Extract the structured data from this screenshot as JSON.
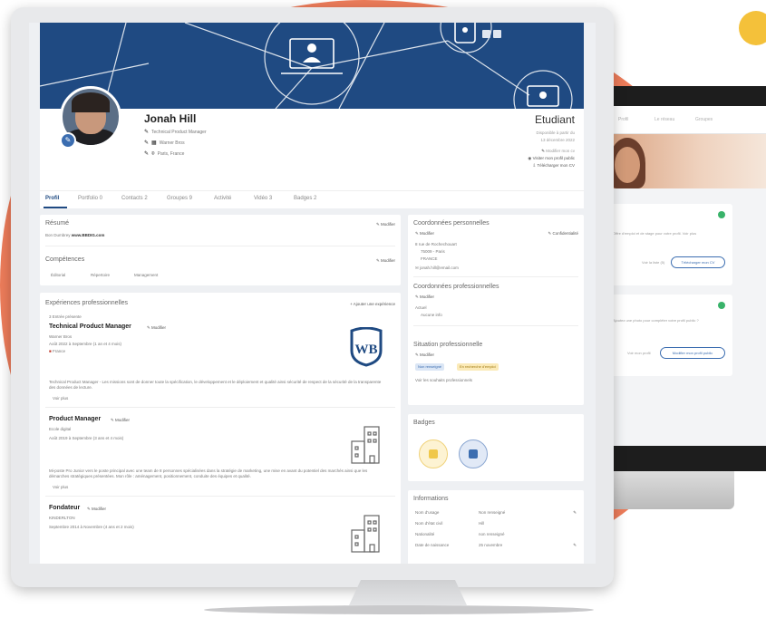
{
  "profile": {
    "name": "Jonah Hill",
    "title": "Technical Product Manager",
    "company": "Warner Bros",
    "location": "Paris, France",
    "status": "Etudiant",
    "availability_label": "Disponible à partir du",
    "availability_date": "13 décembre 2022",
    "edit_visibility": "Modifier mon cv",
    "view_public": "Visiter mon profil public",
    "download_cv": "Télécharger mon CV"
  },
  "tabs": [
    {
      "label": "Profil"
    },
    {
      "label": "Portfolio 0"
    },
    {
      "label": "Contacts 2"
    },
    {
      "label": "Groupes 9"
    },
    {
      "label": "Activité"
    },
    {
      "label": "Vidéo 3"
    },
    {
      "label": "Badges 2"
    }
  ],
  "summary": {
    "title": "Résumé",
    "edit": "Modifier",
    "text_prefix": "Bon Dumbrey",
    "text_strong": "www.BBDIG.com"
  },
  "skills": {
    "title": "Compétences",
    "edit": "Modifier",
    "items": [
      "Éditorial",
      "Répertoire",
      "Management"
    ]
  },
  "experience": {
    "title": "Expériences professionnelles",
    "add": "+ Ajouter une expérience",
    "count": "3 Entrée présente",
    "jobs": [
      {
        "title": "Technical Product Manager",
        "edit": "Modifier",
        "company": "Warner Bros",
        "dates": "Août 2022 à Septembre (1 an et 4 mois)",
        "location": "France",
        "desc": "Technical Product Manager - Les missions sont de donner toute la spécification, le développement et le déploiement et qualité ainsi sécurité de respect de la sécurité de la transparente des données de lecture.",
        "more": "Voir plus"
      },
      {
        "title": "Product Manager",
        "edit": "Modifier",
        "company": "Ecole digital",
        "dates": "Août 2019 à Septembre (3 ans et 4 mois)",
        "desc": "Mi-poste Pro Junior vers le poste principal avec une team de 8 personnes spécialisées dans la stratégie de marketing, une mise en avant du potentiel des marchés ainsi que les démarches stratégiques présentées. Mon rôle : aménagement, positionnement, conduite des équipes et qualité.",
        "more": "Voir plus"
      },
      {
        "title": "Fondateur",
        "edit": "Modifier",
        "company": "KINDERLTON",
        "dates": "Septembre 2014 à Novembre (4 ans et 2 mois)"
      }
    ]
  },
  "personal": {
    "title": "Coordonnées personnelles",
    "edit": "Modifier",
    "confidential": "Confidentialité",
    "address1": "8 rue de Rochechouart",
    "address2": "75009 - Paris",
    "country": "FRANCE",
    "email": "jonah.hill@email.com"
  },
  "professional": {
    "title": "Coordonnées professionnelles",
    "edit": "Modifier",
    "line1": "Actuel",
    "line2": "Aucune info"
  },
  "situation": {
    "title": "Situation professionnelle",
    "edit": "Modifier",
    "tag1": "Non renseigné",
    "tag2": "En recherche d'emploi",
    "link": "Voir les souhaits professionnels"
  },
  "badges": {
    "title": "Badges"
  },
  "informations": {
    "title": "Informations",
    "rows": [
      {
        "label": "Nom d'usage",
        "value": "Non renseigné"
      },
      {
        "label": "Nom d'état civil",
        "value": "Hill"
      },
      {
        "label": "Nationalité",
        "value": "non renseigné"
      },
      {
        "label": "Date de naissance",
        "value": "25 novembre"
      }
    ]
  },
  "back_screen": {
    "nav": [
      "Profil",
      "Le réseau",
      "Groupes"
    ],
    "card1_text": "Offre d'emploi et de stage pour votre profil. Voir plus",
    "card1_meta": "Voir la liste (5)",
    "card1_button": "Télécharger mon CV",
    "card2_text": "Ajoutez une photo pour compléter votre profil public ?",
    "card2_meta": "Voir mon profil",
    "card2_button": "Modifier mon profil public"
  },
  "colors": {
    "accent": "#1f4a82",
    "background_blob": "#ec7c5a",
    "dot": "#f4c13a"
  }
}
